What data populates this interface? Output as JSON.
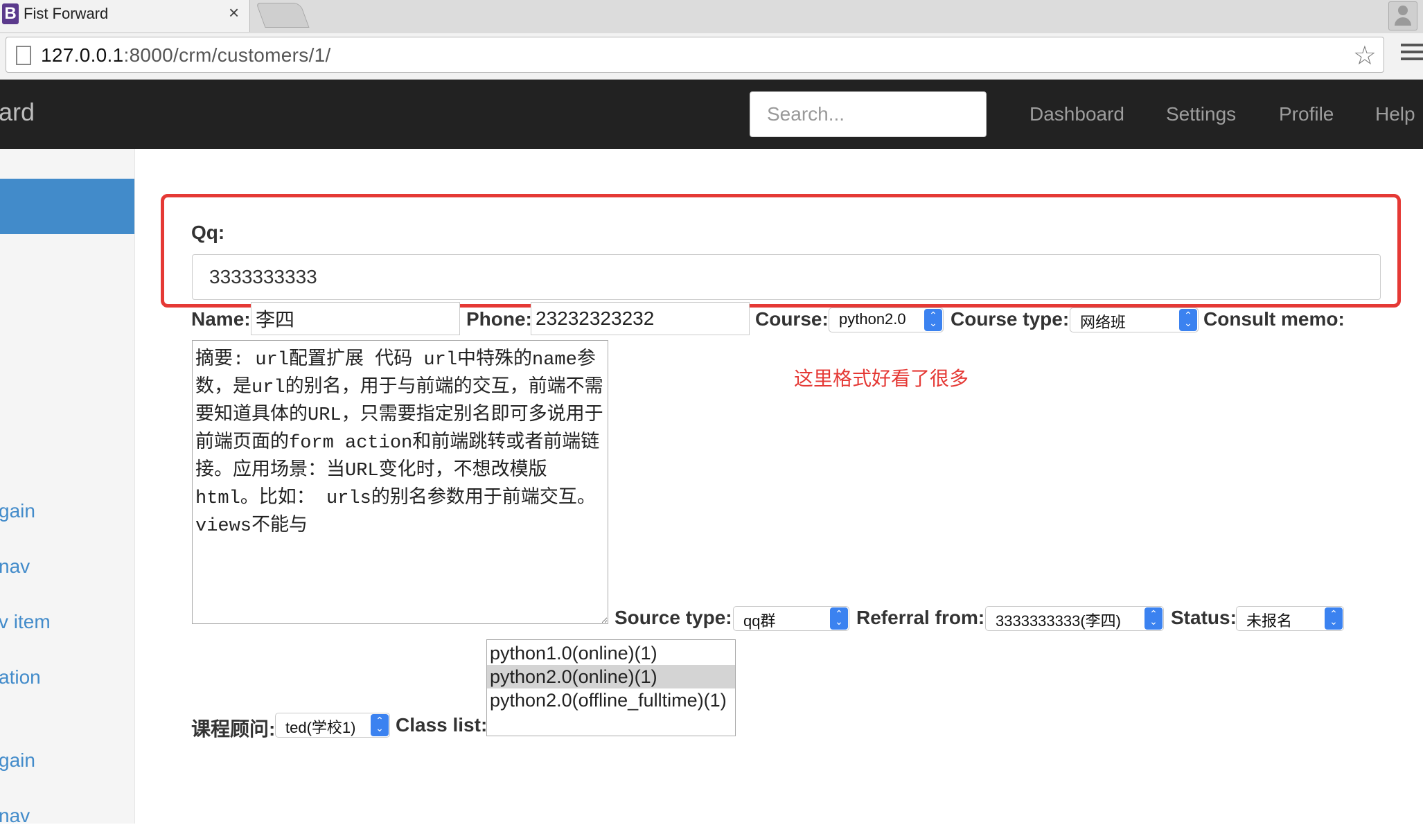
{
  "browser": {
    "tab_title": "Fist Forward",
    "tab_favicon": "B",
    "tab_close": "×",
    "url_host": "127.0.0.1",
    "url_rest": ":8000/crm/customers/1/"
  },
  "navbar": {
    "brand": "ard",
    "search_placeholder": "Search...",
    "links": [
      "Dashboard",
      "Settings",
      "Profile",
      "Help"
    ]
  },
  "sidebar": {
    "items": [
      "gain",
      "nav",
      "v item",
      "ation",
      "gain",
      "nav"
    ]
  },
  "form": {
    "qq_label": "Qq:",
    "qq_value": "3333333333",
    "name_label": "Name:",
    "name_value": "李四",
    "phone_label": "Phone:",
    "phone_value": "23232323232",
    "course_label": "Course:",
    "course_value": "python2.0",
    "course_type_label": "Course type:",
    "course_type_value": "网络班",
    "consult_memo_label": "Consult memo:",
    "consult_memo_value": "摘要: url配置扩展 代码 url中特殊的name参数，是url的别名，用于与前端的交互，前端不需要知道具体的URL，只需要指定别名即可多说用于前端页面的form action和前端跳转或者前端链接。应用场景：当URL变化时，不想改模版html。比如： urls的别名参数用于前端交互。views不能与",
    "source_type_label": "Source type:",
    "source_type_value": "qq群",
    "referral_label": "Referral from:",
    "referral_value": "3333333333(李四)",
    "status_label": "Status:",
    "status_value": "未报名",
    "consultant_label": "课程顾问:",
    "consultant_value": "ted(学校1)",
    "class_list_label": "Class list:",
    "class_list_options": [
      {
        "label": "python1.0(online)(1)",
        "selected": false
      },
      {
        "label": "python2.0(online)(1)",
        "selected": true
      },
      {
        "label": "python2.0(offline_fulltime)(1)",
        "selected": false
      }
    ]
  },
  "annotation": {
    "text": "这里格式好看了很多",
    "color": "#e53935"
  },
  "colors": {
    "navbar_bg": "#222222",
    "sidebar_active": "#428bca",
    "link": "#428bca"
  }
}
